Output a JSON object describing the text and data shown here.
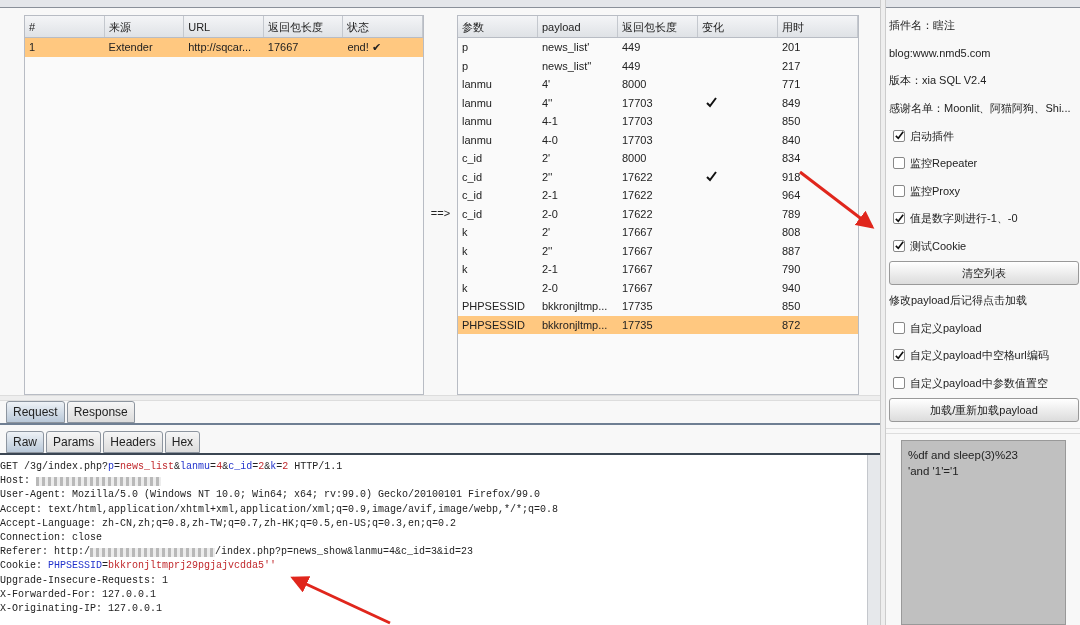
{
  "scan_table": {
    "columns": [
      "#",
      "来源",
      "URL",
      "返回包长度",
      "状态"
    ],
    "rows": [
      {
        "cells": [
          "1",
          "Extender",
          "http://sqcar...",
          "17667",
          "end! ✔"
        ],
        "selected": true
      }
    ]
  },
  "arrow_label": "==>",
  "result_table": {
    "columns": [
      "参数",
      "payload",
      "返回包长度",
      "变化",
      "用时"
    ],
    "rows": [
      {
        "cells": [
          "p",
          "news_list'",
          "449",
          "201"
        ],
        "changed": false,
        "selected": false
      },
      {
        "cells": [
          "p",
          "news_list''",
          "449",
          "217"
        ],
        "changed": false,
        "selected": false
      },
      {
        "cells": [
          "lanmu",
          "4'",
          "8000",
          "771"
        ],
        "changed": false,
        "selected": false
      },
      {
        "cells": [
          "lanmu",
          "4''",
          "17703",
          "849"
        ],
        "changed": true,
        "selected": false
      },
      {
        "cells": [
          "lanmu",
          "4-1",
          "17703",
          "850"
        ],
        "changed": false,
        "selected": false
      },
      {
        "cells": [
          "lanmu",
          "4-0",
          "17703",
          "840"
        ],
        "changed": false,
        "selected": false
      },
      {
        "cells": [
          "c_id",
          "2'",
          "8000",
          "834"
        ],
        "changed": false,
        "selected": false
      },
      {
        "cells": [
          "c_id",
          "2''",
          "17622",
          "918"
        ],
        "changed": true,
        "selected": false
      },
      {
        "cells": [
          "c_id",
          "2-1",
          "17622",
          "964"
        ],
        "changed": false,
        "selected": false
      },
      {
        "cells": [
          "c_id",
          "2-0",
          "17622",
          "789"
        ],
        "changed": false,
        "selected": false
      },
      {
        "cells": [
          "k",
          "2'",
          "17667",
          "808"
        ],
        "changed": false,
        "selected": false
      },
      {
        "cells": [
          "k",
          "2''",
          "17667",
          "887"
        ],
        "changed": false,
        "selected": false
      },
      {
        "cells": [
          "k",
          "2-1",
          "17667",
          "790"
        ],
        "changed": false,
        "selected": false
      },
      {
        "cells": [
          "k",
          "2-0",
          "17667",
          "940"
        ],
        "changed": false,
        "selected": false
      },
      {
        "cells": [
          "PHPSESSID",
          "bkkronjltmp...",
          "17735",
          "850"
        ],
        "changed": false,
        "selected": false
      },
      {
        "cells": [
          "PHPSESSID",
          "bkkronjltmp...",
          "17735",
          "872"
        ],
        "changed": false,
        "selected": true
      }
    ]
  },
  "message_tabs": [
    {
      "label": "Request",
      "selected": true
    },
    {
      "label": "Response",
      "selected": false
    }
  ],
  "view_tabs": [
    {
      "label": "Raw",
      "selected": true
    },
    {
      "label": "Params",
      "selected": false
    },
    {
      "label": "Headers",
      "selected": false
    },
    {
      "label": "Hex",
      "selected": false
    }
  ],
  "request_lines": [
    [
      {
        "kind": "plain",
        "text": "GET /3g/index.php?"
      },
      {
        "kind": "name",
        "text": "p"
      },
      {
        "kind": "plain",
        "text": "="
      },
      {
        "kind": "value",
        "text": "news_list"
      },
      {
        "kind": "plain",
        "text": "&"
      },
      {
        "kind": "name",
        "text": "lanmu"
      },
      {
        "kind": "plain",
        "text": "="
      },
      {
        "kind": "value",
        "text": "4"
      },
      {
        "kind": "plain",
        "text": "&"
      },
      {
        "kind": "name",
        "text": "c_id"
      },
      {
        "kind": "plain",
        "text": "="
      },
      {
        "kind": "value",
        "text": "2"
      },
      {
        "kind": "plain",
        "text": "&"
      },
      {
        "kind": "name",
        "text": "k"
      },
      {
        "kind": "plain",
        "text": "="
      },
      {
        "kind": "value",
        "text": "2"
      },
      {
        "kind": "plain",
        "text": " HTTP/1.1"
      }
    ],
    [
      {
        "kind": "plain",
        "text": "Host: "
      },
      {
        "kind": "redacted"
      }
    ],
    [
      {
        "kind": "plain",
        "text": "User-Agent: Mozilla/5.0 (Windows NT 10.0; Win64; x64; rv:99.0) Gecko/20100101 Firefox/99.0"
      }
    ],
    [
      {
        "kind": "plain",
        "text": "Accept: text/html,application/xhtml+xml,application/xml;q=0.9,image/avif,image/webp,*/*;q=0.8"
      }
    ],
    [
      {
        "kind": "plain",
        "text": "Accept-Language: zh-CN,zh;q=0.8,zh-TW;q=0.7,zh-HK;q=0.5,en-US;q=0.3,en;q=0.2"
      }
    ],
    [
      {
        "kind": "plain",
        "text": "Connection: close"
      }
    ],
    [
      {
        "kind": "plain",
        "text": "Referer: http:/"
      },
      {
        "kind": "redacted"
      },
      {
        "kind": "plain",
        "text": "/index.php?p=news_show&lanmu=4&c_id=3&id=23"
      }
    ],
    [
      {
        "kind": "plain",
        "text": "Cookie: "
      },
      {
        "kind": "name",
        "text": "PHPSESSID"
      },
      {
        "kind": "plain",
        "text": "="
      },
      {
        "kind": "value",
        "text": "bkkronjltmprj29pgjajvcdda5''"
      }
    ],
    [
      {
        "kind": "plain",
        "text": "Upgrade-Insecure-Requests: 1"
      }
    ],
    [
      {
        "kind": "plain",
        "text": "X-Forwarded-For: 127.0.0.1"
      }
    ],
    [
      {
        "kind": "plain",
        "text": "X-Originating-IP: 127.0.0.1"
      }
    ]
  ],
  "side_panel": [
    {
      "kind": "text",
      "text": "插件名：瞎注"
    },
    {
      "kind": "text",
      "text": "blog:www.nmd5.com"
    },
    {
      "kind": "text",
      "text": "版本：xia SQL V2.4"
    },
    {
      "kind": "text",
      "text": "感谢名单：Moonlit、阿猫阿狗、Shi..."
    },
    {
      "kind": "checkbox",
      "text": "启动插件",
      "checked": true
    },
    {
      "kind": "checkbox",
      "text": "监控Repeater",
      "checked": false
    },
    {
      "kind": "checkbox",
      "text": "监控Proxy",
      "checked": false
    },
    {
      "kind": "checkbox",
      "text": "值是数字则进行-1、-0",
      "checked": true
    },
    {
      "kind": "checkbox",
      "text": "测试Cookie",
      "checked": true
    },
    {
      "kind": "button",
      "text": "清空列表"
    },
    {
      "kind": "text",
      "text": "修改payload后记得点击加载"
    },
    {
      "kind": "checkbox",
      "text": "自定义payload",
      "checked": false
    },
    {
      "kind": "checkbox",
      "text": "自定义payload中空格url编码",
      "checked": true
    },
    {
      "kind": "checkbox",
      "text": "自定义payload中参数值置空",
      "checked": false
    },
    {
      "kind": "button",
      "text": "加载/重新加载payload"
    }
  ],
  "payload_lines": [
    "%df and sleep(3)%23",
    "'and '1'='1"
  ]
}
